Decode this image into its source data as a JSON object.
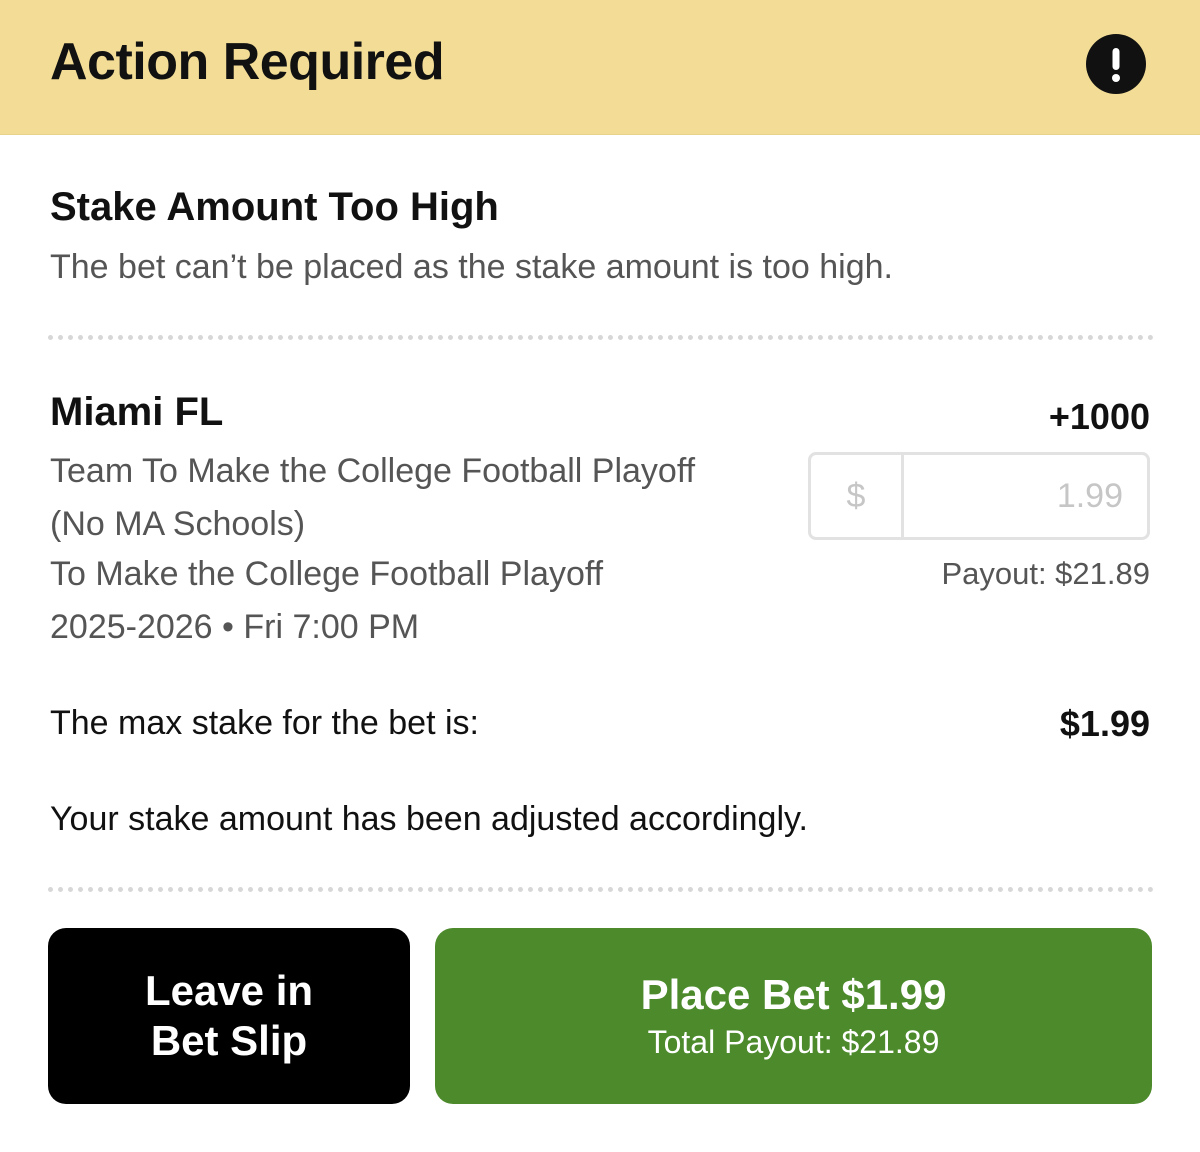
{
  "header": {
    "title": "Action Required",
    "icon": "alert-icon",
    "background_color": "#f3dd96"
  },
  "error": {
    "title": "Stake Amount Too High",
    "message": "The bet can’t be placed as the stake amount is too high."
  },
  "selection": {
    "team": "Miami FL",
    "odds": "+1000",
    "market_line1": "Team To Make the College Football Playoff",
    "market_line2": "(No MA Schools)",
    "event_name": "To Make the College Football Playoff",
    "event_date": "2025-2026",
    "event_separator": " • ",
    "event_time": "Fri 7:00 PM"
  },
  "stake": {
    "currency_symbol": "$",
    "value": "1.99",
    "payout": "Payout: $21.89"
  },
  "max_stake": {
    "label": "The max stake for the bet is:",
    "value": "$1.99"
  },
  "adjusted_message": "Your stake amount has been adjusted accordingly.",
  "buttons": {
    "leave_line1": "Leave in",
    "leave_line2": "Bet Slip",
    "place_label": "Place Bet $1.99",
    "place_sub": "Total Payout: $21.89",
    "leave_color": "#000000",
    "place_color": "#4c8a2b"
  }
}
